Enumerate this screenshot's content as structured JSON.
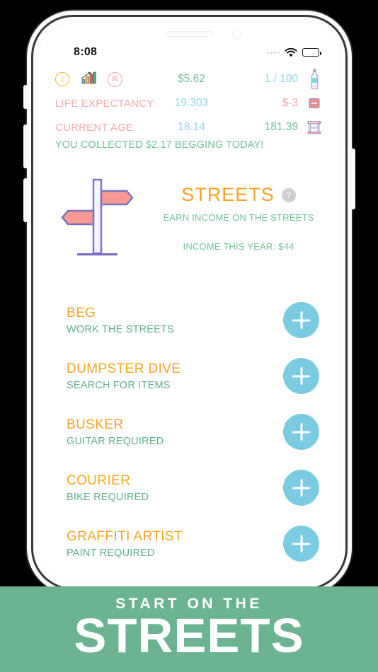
{
  "status_bar": {
    "time": "8:08",
    "signal_icon": "signal-dots-icon",
    "wifi_icon": "wifi-icon",
    "battery_icon": "battery-full-icon"
  },
  "stats": {
    "rows": [
      {
        "icons": [
          "info-icon",
          "stock-chart-icon",
          "registered-r-icon"
        ],
        "label": "",
        "middle": "$5.62",
        "right": "1 / 100",
        "right_icon": "water-bottle-icon"
      },
      {
        "icons": [],
        "label": "LIFE EXPECTANCY",
        "middle": "19.303",
        "right": "$-3",
        "right_icon": "red-pill-icon"
      },
      {
        "icons": [],
        "label": "CURRENT AGE",
        "middle": "18.14",
        "right": "181.39",
        "right_icon": "market-stall-icon"
      }
    ],
    "collected_message": "YOU COLLECTED $2.17 BEGGING TODAY!"
  },
  "title_block": {
    "icon": "signpost-icon",
    "title": "STREETS",
    "help_badge": "?",
    "subtitle": "EARN INCOME ON THE STREETS",
    "income": "INCOME THIS YEAR: $44"
  },
  "jobs": [
    {
      "title": "BEG",
      "subtitle": "WORK THE STREETS",
      "action": "+"
    },
    {
      "title": "DUMPSTER DIVE",
      "subtitle": "SEARCH FOR ITEMS",
      "action": "+"
    },
    {
      "title": "BUSKER",
      "subtitle": "GUITAR REQUIRED",
      "action": "+"
    },
    {
      "title": "COURIER",
      "subtitle": "BIKE REQUIRED",
      "action": "+"
    },
    {
      "title": "GRAFFITI ARTIST",
      "subtitle": "PAINT REQUIRED",
      "action": "+"
    }
  ],
  "banner": {
    "line1": "START ON THE",
    "line2": "STREETS"
  },
  "colors": {
    "accent_orange": "#f5a524",
    "green": "#6ec394",
    "blue": "#92d5ea",
    "pink": "#f6a9a9",
    "add_button": "#7bcbe2",
    "banner_bg": "#6cb391",
    "signpost_post": "#7a72bf",
    "signpost_arrow": "#f79a94"
  }
}
